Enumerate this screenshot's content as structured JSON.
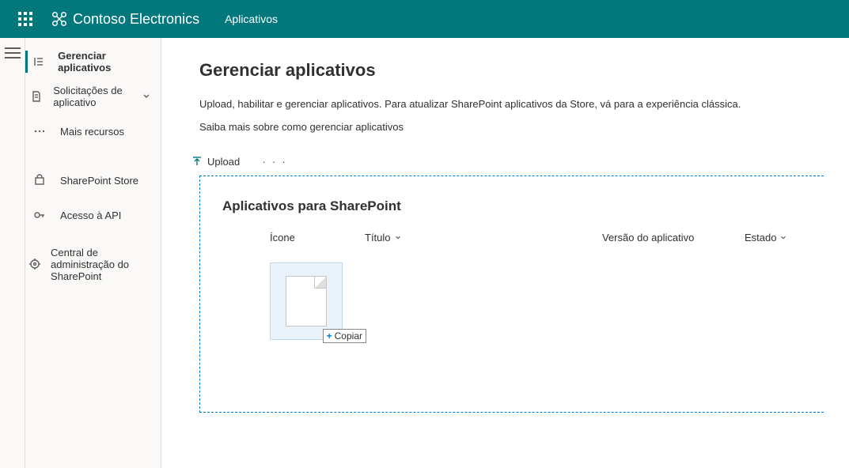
{
  "header": {
    "brand": "Contoso Electronics",
    "section": "Aplicativos"
  },
  "sidebar": {
    "items": [
      {
        "label": "Gerenciar aplicativos"
      },
      {
        "label": "Solicitações de aplicativo"
      },
      {
        "label": "Mais recursos"
      },
      {
        "label": "SharePoint Store"
      },
      {
        "label": "Acesso à API"
      },
      {
        "label": "Central de administração do SharePoint"
      }
    ]
  },
  "main": {
    "title": "Gerenciar aplicativos",
    "description": "Upload, habilitar e gerenciar aplicativos. Para atualizar SharePoint aplicativos da Store, vá para a experiência clássica.",
    "learn_more": "Saiba mais sobre como gerenciar aplicativos",
    "upload_label": "Upload",
    "section_title": "Aplicativos para SharePoint",
    "columns": {
      "icon": "Ícone",
      "title": "Título",
      "version": "Versão do aplicativo",
      "state": "Estado"
    },
    "copy_badge": "Copiar"
  }
}
